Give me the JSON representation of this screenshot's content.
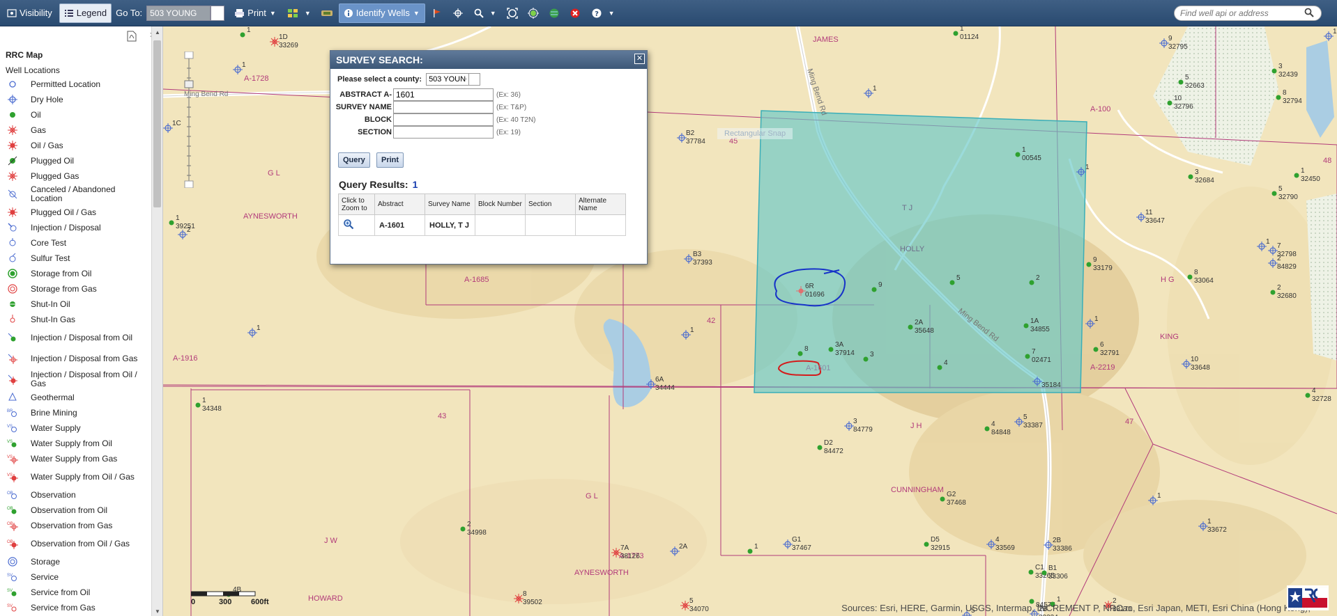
{
  "toolbar": {
    "visibility_label": "Visibility",
    "legend_label": "Legend",
    "goto_label": "Go To:",
    "goto_value": "503 YOUNG",
    "print_label": "Print",
    "identify_label": "Identify Wells",
    "search_placeholder": "Find well api or address"
  },
  "legend": {
    "title": "RRC Map",
    "subtitle": "Well Locations",
    "items": [
      {
        "label": "Permitted Location",
        "symbol": "circle-open"
      },
      {
        "label": "Dry Hole",
        "symbol": "dry-hole"
      },
      {
        "label": "Oil",
        "symbol": "circle-green"
      },
      {
        "label": "Gas",
        "symbol": "gas-star"
      },
      {
        "label": "Oil / Gas",
        "symbol": "oilgas-star"
      },
      {
        "label": "Plugged Oil",
        "symbol": "plugged-oil"
      },
      {
        "label": "Plugged Gas",
        "symbol": "plugged-gas"
      },
      {
        "label": "Canceled / Abandoned Location",
        "symbol": "canceled"
      },
      {
        "label": "Plugged Oil / Gas",
        "symbol": "plugged-oilgas"
      },
      {
        "label": "Injection / Disposal",
        "symbol": "injection"
      },
      {
        "label": "Core Test",
        "symbol": "core-test"
      },
      {
        "label": "Sulfur Test",
        "symbol": "sulfur-test"
      },
      {
        "label": "Storage from Oil",
        "symbol": "storage-oil"
      },
      {
        "label": "Storage from Gas",
        "symbol": "storage-gas"
      },
      {
        "label": "Shut-In Oil",
        "symbol": "shutin-oil"
      },
      {
        "label": "Shut-In Gas",
        "symbol": "shutin-gas"
      },
      {
        "label": "Injection / Disposal from Oil",
        "symbol": "inj-oil"
      },
      {
        "label": "Injection / Disposal from Gas",
        "symbol": "inj-gas"
      },
      {
        "label": "Injection / Disposal from Oil / Gas",
        "symbol": "inj-oilgas"
      },
      {
        "label": "Geothermal",
        "symbol": "geothermal"
      },
      {
        "label": "Brine Mining",
        "symbol": "brine"
      },
      {
        "label": "Water Supply",
        "symbol": "water-supply"
      },
      {
        "label": "Water Supply from Oil",
        "symbol": "ws-oil"
      },
      {
        "label": "Water Supply from Gas",
        "symbol": "ws-gas"
      },
      {
        "label": "Water Supply from Oil / Gas",
        "symbol": "ws-oilgas"
      },
      {
        "label": "Observation",
        "symbol": "observation"
      },
      {
        "label": "Observation from Oil",
        "symbol": "obs-oil"
      },
      {
        "label": "Observation from Gas",
        "symbol": "obs-gas"
      },
      {
        "label": "Observation from Oil / Gas",
        "symbol": "obs-oilgas"
      },
      {
        "label": "Storage",
        "symbol": "storage"
      },
      {
        "label": "Service",
        "symbol": "service"
      },
      {
        "label": "Service from Oil",
        "symbol": "svc-oil"
      },
      {
        "label": "Service from Gas",
        "symbol": "svc-gas"
      }
    ]
  },
  "dialog": {
    "title": "SURVEY SEARCH:",
    "county_label": "Please select a county:",
    "county_value": "503 YOUNG",
    "fields": [
      {
        "label": "ABSTRACT A-",
        "value": "1601",
        "hint": "(Ex: 36)"
      },
      {
        "label": "SURVEY NAME",
        "value": "",
        "hint": "(Ex: T&P)"
      },
      {
        "label": "BLOCK",
        "value": "",
        "hint": "(Ex: 40 T2N)"
      },
      {
        "label": "SECTION",
        "value": "",
        "hint": "(Ex: 19)"
      }
    ],
    "query_label": "Query",
    "print_label": "Print",
    "results_title": "Query Results:",
    "results_count": "1",
    "columns": [
      "Click to Zoom to",
      "Abstract",
      "Survey Name",
      "Block Number",
      "Section",
      "Alternate Name"
    ],
    "rows": [
      {
        "abstract": "A-1601",
        "survey_name": "HOLLY, T J",
        "block": "",
        "section": "",
        "alternate": ""
      }
    ]
  },
  "map": {
    "attribution": "Sources: Esri, HERE, Garmin, USGS, Intermap, INCREMENT P, NRCan, Esri Japan, METI, Esri China (Hong Kong),",
    "scale": {
      "l0": "0",
      "l1": "300",
      "l2": "600ft"
    },
    "rect_snap_label": "Rectangular Snap",
    "road_label": "Ming Bend Rd",
    "surveys": [
      "JAMES",
      "A-1728",
      "G L",
      "AYNESWORTH",
      "45",
      "A-1685",
      "42",
      "A-1916",
      "43",
      "T J",
      "HOLLY",
      "A-1601",
      "J H",
      "47",
      "A-2219",
      "A-100",
      "H G",
      "KING",
      "G L",
      "CUNNINGHAM",
      "A-1773",
      "AYNESWORTH",
      "J W",
      "HOWARD",
      "48"
    ],
    "wells": [
      {
        "id": "1",
        "api": ""
      },
      {
        "id": "1D",
        "api": "33269"
      },
      {
        "id": "1",
        "api": ""
      },
      {
        "id": "1C",
        "api": ""
      },
      {
        "id": "1",
        "api": "01124"
      },
      {
        "id": "9",
        "api": "32795"
      },
      {
        "id": "1",
        "api": ""
      },
      {
        "id": "1",
        "api": ""
      },
      {
        "id": "5",
        "api": "32663"
      },
      {
        "id": "3",
        "api": "32439"
      },
      {
        "id": "10",
        "api": "32796"
      },
      {
        "id": "8",
        "api": "32794"
      },
      {
        "id": "B2",
        "api": "37784"
      },
      {
        "id": "1",
        "api": "00545"
      },
      {
        "id": "1",
        "api": ""
      },
      {
        "id": "3",
        "api": "32684"
      },
      {
        "id": "5",
        "api": "32790"
      },
      {
        "id": "1",
        "api": "32450"
      },
      {
        "id": "1",
        "api": "39251"
      },
      {
        "id": "2",
        "api": ""
      },
      {
        "id": "11",
        "api": "33647"
      },
      {
        "id": "7",
        "api": "32798"
      },
      {
        "id": "B3",
        "api": "37393"
      },
      {
        "id": "9",
        "api": "33179"
      },
      {
        "id": "8",
        "api": "33064"
      },
      {
        "id": "2",
        "api": "84829"
      },
      {
        "id": "2",
        "api": "32680"
      },
      {
        "id": "1",
        "api": ""
      },
      {
        "id": "6R",
        "api": "01696"
      },
      {
        "id": "9",
        "api": ""
      },
      {
        "id": "5",
        "api": ""
      },
      {
        "id": "2",
        "api": ""
      },
      {
        "id": "2A",
        "api": "35648"
      },
      {
        "id": "1A",
        "api": "34855"
      },
      {
        "id": "1",
        "api": ""
      },
      {
        "id": "1",
        "api": ""
      },
      {
        "id": "1",
        "api": ""
      },
      {
        "id": "8",
        "api": ""
      },
      {
        "id": "3A",
        "api": "37914"
      },
      {
        "id": "3",
        "api": ""
      },
      {
        "id": "4",
        "api": ""
      },
      {
        "id": "7",
        "api": "02471"
      },
      {
        "id": "6",
        "api": "32791"
      },
      {
        "id": "10",
        "api": "33648"
      },
      {
        "id": "6A",
        "api": "34444"
      },
      {
        "id": "",
        "api": "35184"
      },
      {
        "id": "4",
        "api": "32728"
      },
      {
        "id": "1",
        "api": "34348"
      },
      {
        "id": "3",
        "api": "84779"
      },
      {
        "id": "4",
        "api": "84848"
      },
      {
        "id": "5",
        "api": "33387"
      },
      {
        "id": "D2",
        "api": "84472"
      },
      {
        "id": "G2",
        "api": "37468"
      },
      {
        "id": "1",
        "api": ""
      },
      {
        "id": "1",
        "api": "33672"
      },
      {
        "id": "2",
        "api": "34998"
      },
      {
        "id": "7A",
        "api": "38126"
      },
      {
        "id": "2A",
        "api": ""
      },
      {
        "id": "1",
        "api": ""
      },
      {
        "id": "G1",
        "api": "37467"
      },
      {
        "id": "D5",
        "api": "32915"
      },
      {
        "id": "4",
        "api": "33569"
      },
      {
        "id": "2B",
        "api": "33386"
      },
      {
        "id": "C1",
        "api": "33265"
      },
      {
        "id": "B1",
        "api": "33306"
      },
      {
        "id": "",
        "api": "84575"
      },
      {
        "id": "4B",
        "api": ""
      },
      {
        "id": "8",
        "api": "39502"
      },
      {
        "id": "5",
        "api": "34070"
      },
      {
        "id": "5",
        "api": "33359"
      },
      {
        "id": "2B",
        "api": "33334"
      },
      {
        "id": "1",
        "api": ""
      },
      {
        "id": "2",
        "api": "33171"
      }
    ]
  },
  "colors": {
    "toolbar": "#2f5079",
    "highlight_fill": "#66c8c8",
    "survey_line": "#b23a7a",
    "oil_well": "#2fa12f",
    "annotation_blue": "#1733c8",
    "annotation_red": "#d41c1c"
  }
}
